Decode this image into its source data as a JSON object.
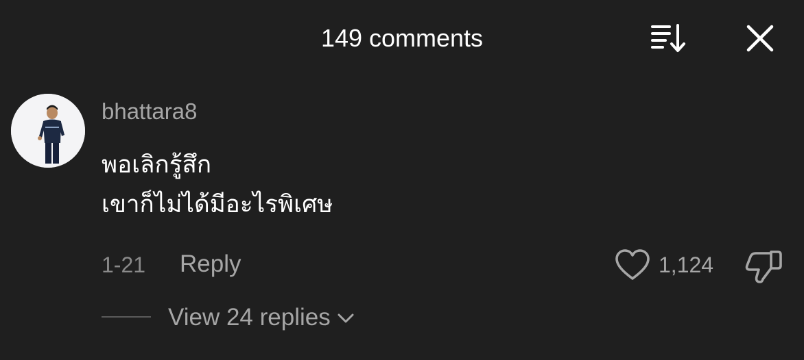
{
  "header": {
    "title": "149 comments"
  },
  "icons": {
    "sort": "sort-icon",
    "close": "close-icon",
    "like": "heart-outline-icon",
    "dislike": "thumbs-down-icon",
    "expand": "chevron-down-icon"
  },
  "comment": {
    "username": "bhattara8",
    "text_lines": [
      "พอเลิกรู้สึก",
      "เขาก็ไม่ได้มีอะไรพิเศษ"
    ],
    "date": "1-21",
    "reply_label": "Reply",
    "like_count": "1,124",
    "view_replies_label": "View 24 replies"
  },
  "colors": {
    "background": "#1f1f1f",
    "primary_text": "#ffffff",
    "secondary_text": "#a6a6a6"
  }
}
